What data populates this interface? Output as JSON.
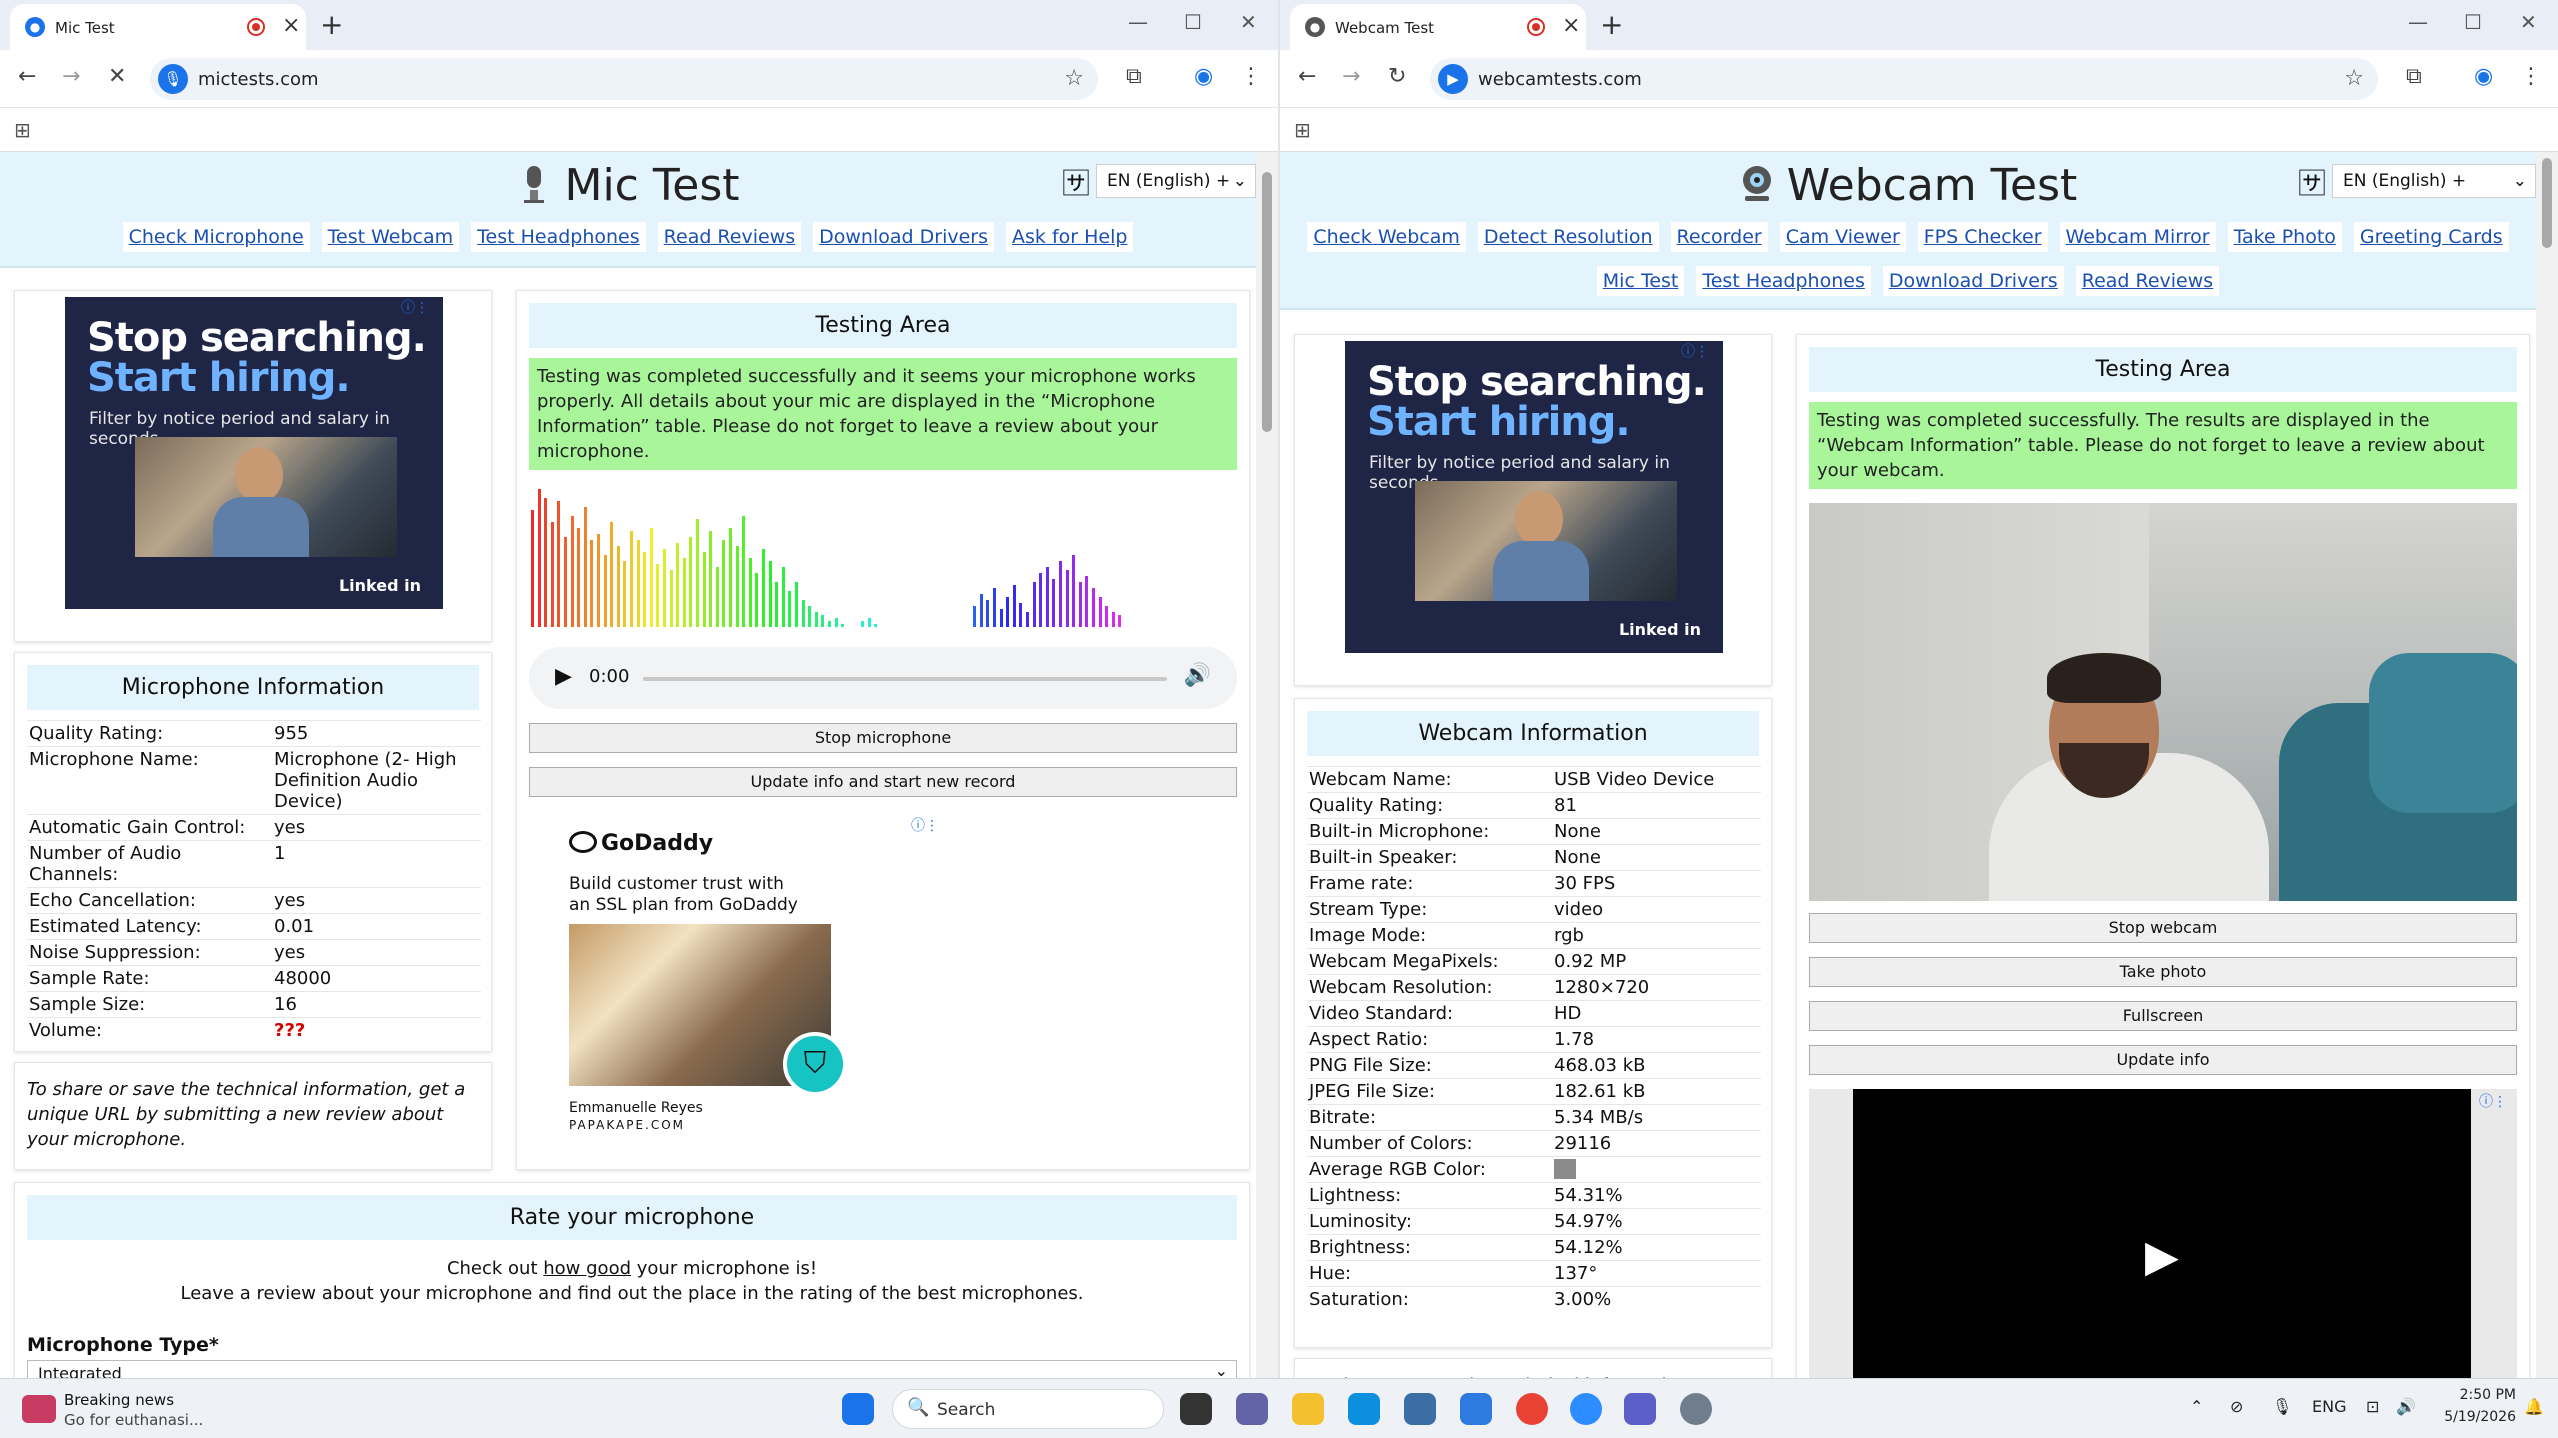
{
  "left_window": {
    "tab_title": "Mic Test",
    "url": "mictests.com",
    "site_title": "Mic Test",
    "language": "EN (English) +",
    "nav": [
      "Check Microphone",
      "Test Webcam",
      "Test Headphones",
      "Read Reviews",
      "Download Drivers",
      "Ask for Help"
    ],
    "ad": {
      "line1": "Stop searching.",
      "line2": "Start hiring.",
      "line3": "Filter by notice period and salary in seconds.",
      "brand": "Linked in"
    },
    "info_title": "Microphone Information",
    "info_rows": [
      {
        "k": "Quality Rating:",
        "v": "955"
      },
      {
        "k": "Microphone Name:",
        "v": "Microphone (2- High Definition Audio Device)"
      },
      {
        "k": "Automatic Gain Control:",
        "v": "yes"
      },
      {
        "k": "Number of Audio Channels:",
        "v": "1"
      },
      {
        "k": "Echo Cancellation:",
        "v": "yes"
      },
      {
        "k": "Estimated Latency:",
        "v": "0.01"
      },
      {
        "k": "Noise Suppression:",
        "v": "yes"
      },
      {
        "k": "Sample Rate:",
        "v": "48000"
      },
      {
        "k": "Sample Size:",
        "v": "16"
      },
      {
        "k": "Volume:",
        "v": "???"
      }
    ],
    "share_note": "To share or save the technical information, get a unique URL by submitting a new review about your microphone.",
    "testing_title": "Testing Area",
    "testing_message": "Testing was completed successfully and it seems your microphone works properly. All details about your mic are displayed in the “Microphone Information” table. Please do not forget to leave a review about your microphone.",
    "player_time": "0:00",
    "stop_button": "Stop microphone",
    "update_button": "Update info and start new record",
    "godaddy": {
      "brand": "GoDaddy",
      "text": "Build customer trust with an SSL plan from GoDaddy",
      "person": "Emmanuelle Reyes",
      "company": "PAPAKAPE.COM"
    },
    "rate_title": "Rate your microphone",
    "rate_line1_pre": "Check out",
    "rate_line1_link": "how good",
    "rate_line1_post": "your microphone is!",
    "rate_line2": "Leave a review about your microphone and find out the place in the rating of the best microphones.",
    "mic_type_label": "Microphone Type*",
    "mic_type_value": "Integrated"
  },
  "right_window": {
    "tab_title": "Webcam Test",
    "url": "webcamtests.com",
    "site_title": "Webcam Test",
    "language": "EN (English) +",
    "nav_row1": [
      "Check Webcam",
      "Detect Resolution",
      "Recorder",
      "Cam Viewer",
      "FPS Checker",
      "Webcam Mirror",
      "Take Photo",
      "Greeting Cards"
    ],
    "nav_row2": [
      "Mic Test",
      "Test Headphones",
      "Download Drivers",
      "Read Reviews"
    ],
    "ad": {
      "line1": "Stop searching.",
      "line2": "Start hiring.",
      "line3": "Filter by notice period and salary in seconds.",
      "brand": "Linked in"
    },
    "info_title": "Webcam Information",
    "info_rows": [
      {
        "k": "Webcam Name:",
        "v": "USB Video Device"
      },
      {
        "k": "Quality Rating:",
        "v": "81"
      },
      {
        "k": "Built-in Microphone:",
        "v": "None"
      },
      {
        "k": "Built-in Speaker:",
        "v": "None"
      },
      {
        "k": "Frame rate:",
        "v": "30 FPS"
      },
      {
        "k": "Stream Type:",
        "v": "video"
      },
      {
        "k": "Image Mode:",
        "v": "rgb"
      },
      {
        "k": "Webcam MegaPixels:",
        "v": "0.92 MP"
      },
      {
        "k": "Webcam Resolution:",
        "v": "1280×720"
      },
      {
        "k": "Video Standard:",
        "v": "HD"
      },
      {
        "k": "Aspect Ratio:",
        "v": "1.78"
      },
      {
        "k": "PNG File Size:",
        "v": "468.03 kB"
      },
      {
        "k": "JPEG File Size:",
        "v": "182.61 kB"
      },
      {
        "k": "Bitrate:",
        "v": "5.34 MB/s"
      },
      {
        "k": "Number of Colors:",
        "v": "29116"
      },
      {
        "k": "Average RGB Color:",
        "v": ""
      },
      {
        "k": "Lightness:",
        "v": "54.31%"
      },
      {
        "k": "Luminosity:",
        "v": "54.97%"
      },
      {
        "k": "Brightness:",
        "v": "54.12%"
      },
      {
        "k": "Hue:",
        "v": "137°"
      },
      {
        "k": "Saturation:",
        "v": "3.00%"
      }
    ],
    "avg_color": "#8a8a8a",
    "share_note_partial": "To share or save the technical information, get a",
    "testing_title": "Testing Area",
    "testing_message": "Testing was completed successfully. The results are displayed in the “Webcam Information” table. Please do not forget to leave a review about your webcam.",
    "buttons": [
      "Stop webcam",
      "Take photo",
      "Fullscreen",
      "Update info"
    ]
  },
  "taskbar": {
    "news_title": "Breaking news",
    "news_sub": "Go for euthanasi...",
    "search": "Search",
    "lang": "ENG",
    "time": "2:50 PM",
    "date": "5/19/2026"
  },
  "colors": {
    "accent": "#1a73e8",
    "header_bg": "#e3f4fc",
    "success_bg": "#a8f59a",
    "link": "#1a4fb3"
  }
}
